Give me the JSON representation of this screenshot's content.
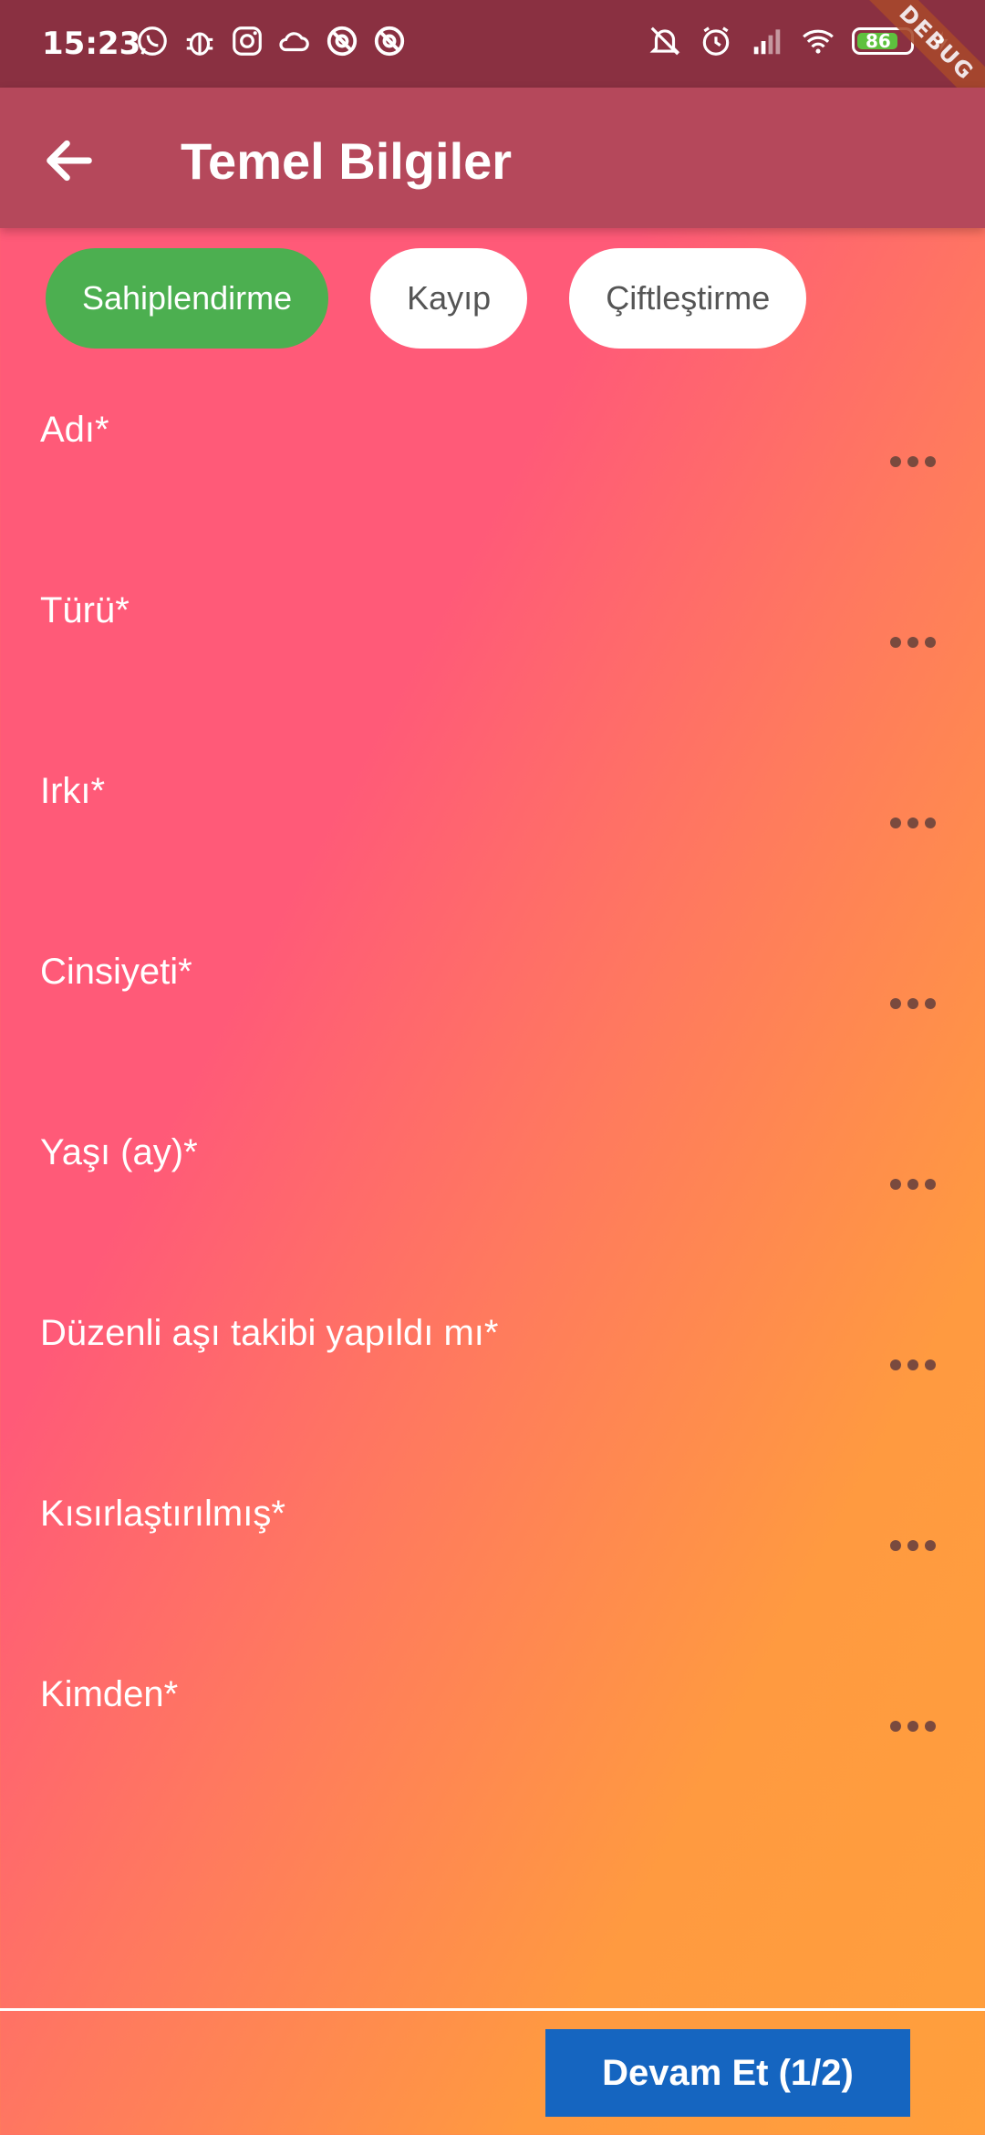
{
  "status_bar": {
    "time": "15:23",
    "left_icons": [
      "whatsapp-icon",
      "bug-icon",
      "instagram-icon",
      "cloud-icon",
      "at-icon",
      "at-icon"
    ],
    "right_icons": [
      "mute-icon",
      "alarm-icon",
      "signal-icon",
      "wifi-icon",
      "battery-icon",
      "charging-icon"
    ],
    "battery_level": "86",
    "debug_banner": "DEBUG"
  },
  "app_bar": {
    "title": "Temel Bilgiler",
    "back_icon": "arrow-left-icon"
  },
  "chips": [
    {
      "label": "Sahiplendirme",
      "selected": true
    },
    {
      "label": "Kayıp",
      "selected": false
    },
    {
      "label": "Çiftleştirme",
      "selected": false
    }
  ],
  "fields": [
    {
      "label": "Adı*"
    },
    {
      "label": "Türü*"
    },
    {
      "label": "Irkı*"
    },
    {
      "label": "Cinsiyeti*"
    },
    {
      "label": "Yaşı (ay)*"
    },
    {
      "label": "Düzenli aşı takibi yapıldı mı*"
    },
    {
      "label": "Kısırlaştırılmış*"
    },
    {
      "label": "Kimden*"
    }
  ],
  "footer": {
    "continue_label": "Devam Et (1/2)"
  },
  "colors": {
    "status_bar": "#8a3041",
    "app_bar": "#b5485b",
    "chip_selected": "#4caf50",
    "button": "#1565c0",
    "gradient_start": "#ff5a78",
    "gradient_end": "#ff9f3c"
  }
}
